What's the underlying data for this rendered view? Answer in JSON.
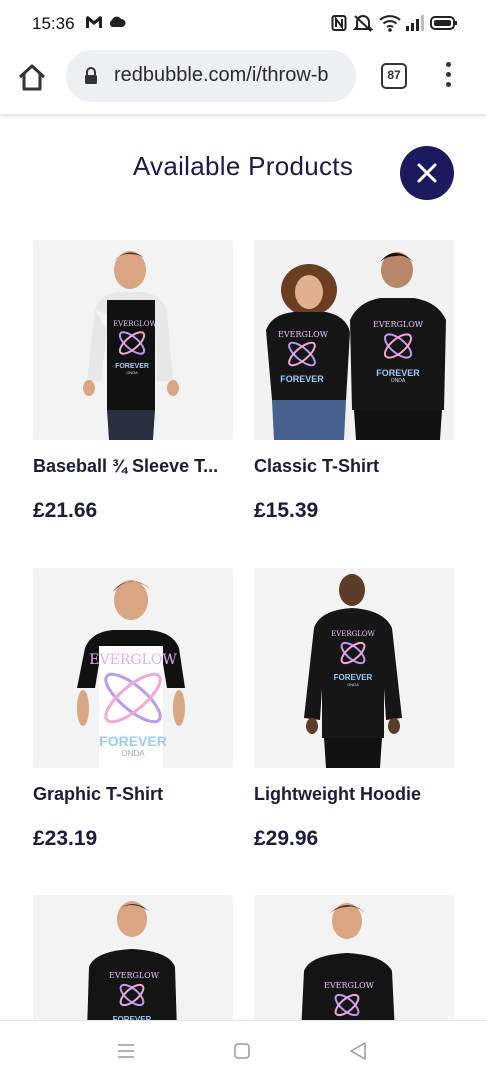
{
  "status_bar": {
    "time": "15:36",
    "icons": [
      "gmail-icon",
      "cloud-icon",
      "nfc-icon",
      "mute-icon",
      "wifi-icon",
      "signal-icon",
      "battery-icon"
    ]
  },
  "browser": {
    "url": "redbubble.com/i/throw-b",
    "tab_count": "87"
  },
  "panel": {
    "title": "Available Products"
  },
  "colors": {
    "accent": "#1c1a5e",
    "text": "#1b1b3a",
    "image_bg": "#f3f3f3"
  },
  "products": [
    {
      "name": "Baseball ¾ Sleeve T...",
      "price": "£21.66"
    },
    {
      "name": "Classic T-Shirt",
      "price": "£15.39"
    },
    {
      "name": "Graphic T-Shirt",
      "price": "£23.19"
    },
    {
      "name": "Lightweight Hoodie",
      "price": "£29.96"
    },
    {
      "name": "",
      "price": ""
    },
    {
      "name": "",
      "price": ""
    }
  ],
  "artwork": {
    "brand": "EVERGLOW",
    "line1": "FOREVER",
    "line2": "ONDA"
  }
}
